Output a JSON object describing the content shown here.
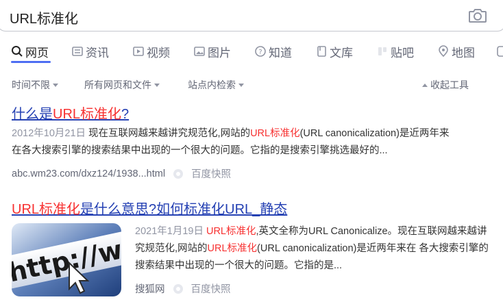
{
  "search": {
    "query": "URL标准化"
  },
  "tabs": [
    {
      "label": "网页",
      "icon": "search-icon"
    },
    {
      "label": "资讯",
      "icon": "news-icon"
    },
    {
      "label": "视频",
      "icon": "video-icon"
    },
    {
      "label": "图片",
      "icon": "image-icon"
    },
    {
      "label": "知道",
      "icon": "question-icon"
    },
    {
      "label": "文库",
      "icon": "document-icon"
    },
    {
      "label": "贴吧",
      "icon": "tieba-icon"
    },
    {
      "label": "地图",
      "icon": "map-pin-icon"
    }
  ],
  "filters": {
    "time": "时间不限",
    "type": "所有网页和文件",
    "site": "站点内检索",
    "collapse": "收起工具"
  },
  "results": [
    {
      "title_parts": [
        "什么是",
        "URL标准化",
        "?"
      ],
      "date": "2012年10月21日",
      "snippet_parts": [
        "现在互联网越来越讲究规范化,网站的",
        "URL标准化",
        "(URL canonicalization)是近两年",
        "来在各大搜索引擎的搜索结果中出现的一个很大的问题。它指的是搜索引擎挑选最好的..."
      ],
      "source": "abc.wm23.com/dxz124/1938...html",
      "cache": "百度快照"
    },
    {
      "title_parts": [
        "URL标准化",
        "是什么意思?如何标准化URL_静态"
      ],
      "date": "2021年1月19日",
      "snippet_parts": [
        "URL标准化",
        ",英文全称为URL Canonicalize。现在互联网",
        "越来越讲究规范化,网站的",
        "URL标准化",
        "(URL canonicalization)是近两年来",
        "在 各大搜索引擎的搜索结果中出现的一个很大的问题。它指的是..."
      ],
      "source": "搜狐网",
      "cache": "百度快照",
      "thumbnail_text": "http://ww"
    }
  ]
}
